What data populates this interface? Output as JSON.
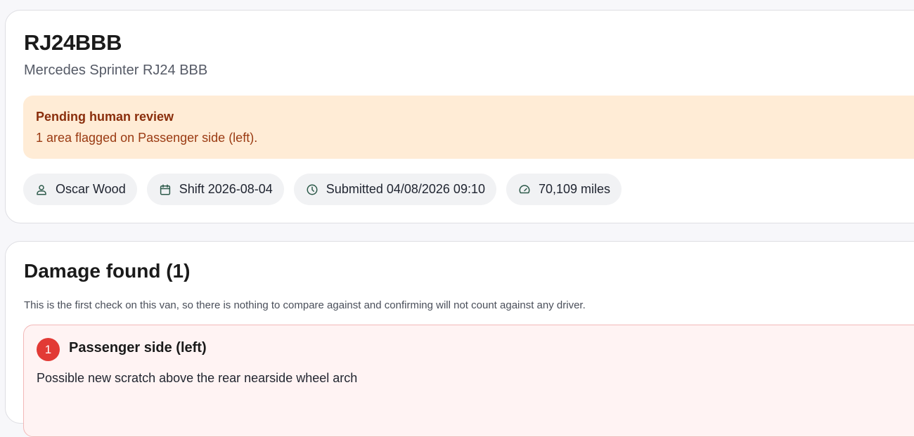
{
  "vehicle": {
    "plate": "RJ24BBB",
    "name": "Mercedes Sprinter RJ24 BBB"
  },
  "review": {
    "title": "Pending human review",
    "text": "1 area flagged on Passenger side (left)."
  },
  "chips": {
    "driver": {
      "icon": "person-icon",
      "label": "Oscar Wood"
    },
    "shift": {
      "icon": "calendar-icon",
      "label": "Shift 2026-08-04"
    },
    "submitted": {
      "icon": "clock-icon",
      "label": "Submitted 04/08/2026 09:10"
    },
    "mileage": {
      "icon": "speedometer-icon",
      "label": "70,109 miles"
    }
  },
  "damage": {
    "title": "Damage found (1)",
    "note": "This is the first check on this van, so there is nothing to compare against and confirming will not count against any driver.",
    "items": [
      {
        "number": "1",
        "area": "Passenger side (left)",
        "description": "Possible new scratch above the rear nearside wheel arch"
      }
    ]
  },
  "colors": {
    "page_bg": "#f7f7fa",
    "banner_bg": "#ffecd6",
    "banner_title": "#8a2e0c",
    "damage_bg": "#fff3f3",
    "damage_badge": "#e23a35",
    "icon_accent": "#2d5a4a"
  }
}
